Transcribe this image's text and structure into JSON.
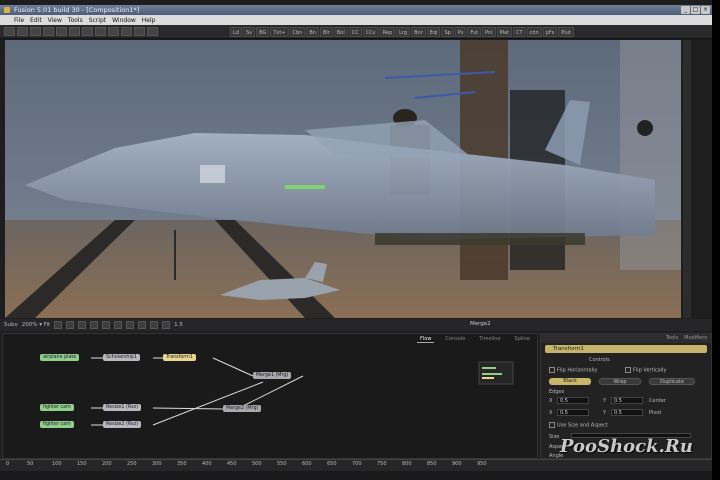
{
  "window": {
    "title": "Fusion 5.01 build 30 - [Composition1*]",
    "buttons": [
      "_",
      "□",
      "×"
    ]
  },
  "menu": [
    "File",
    "Edit",
    "View",
    "Tools",
    "Script",
    "Window",
    "Help"
  ],
  "toolbar": {
    "tools": [
      "Ld",
      "Sv",
      "BG",
      "Txt+",
      "Cbn",
      "Bn",
      "Blr",
      "Bol",
      "CC",
      "CCv",
      "Rep",
      "Lrg",
      "Bnr",
      "Eql",
      "Sp",
      "Ps",
      "Fut",
      "Pnl",
      "Mat",
      "CT",
      "cdn",
      "pFs",
      "Plut"
    ]
  },
  "viewer_bar": {
    "left_label": "Subv",
    "zoom": "200% ▾ Fit",
    "value": "1.5",
    "title": "Merge2"
  },
  "flow": {
    "tabs": [
      "Flow",
      "Console",
      "Timeline",
      "Spline"
    ],
    "nodes": [
      {
        "label": "airplane plate",
        "kind": "loader"
      },
      {
        "label": "Scholarship1",
        "kind": "xf"
      },
      {
        "label": "Transform1",
        "kind": "tr"
      },
      {
        "label": "Merge1 (Mrg)",
        "kind": "mg"
      },
      {
        "label": "fighter cam",
        "kind": "loader"
      },
      {
        "label": "fighter cam",
        "kind": "loader"
      },
      {
        "label": "Resize1 (Rsz)",
        "kind": "xf"
      },
      {
        "label": "Resize2 (Rsz)",
        "kind": "xf"
      },
      {
        "label": "Merge2 (Mrg)",
        "kind": "mg"
      }
    ]
  },
  "inspector": {
    "tabs": [
      "Tools",
      "Modifiers"
    ],
    "header": "Transform1",
    "controls_label": "Controls",
    "flip_h": "Flip Horizontally",
    "flip_v": "Flip Vertically",
    "edge_buttons": [
      "Black",
      "Wrap",
      "Duplicate"
    ],
    "edges_label": "Edges",
    "x_label": "X",
    "x_value": "0.5",
    "y_label": "Y",
    "y_value": "0.5",
    "center_label": "Center",
    "pivot_label": "Pivot",
    "use_size": "Use Size and Aspect",
    "size_label": "Size",
    "aspect_label": "Aspect",
    "angle_label": "Angle"
  },
  "ruler": {
    "ticks": [
      "0",
      "50",
      "100",
      "150",
      "200",
      "250",
      "300",
      "350",
      "400",
      "450",
      "500",
      "550",
      "600",
      "650",
      "700",
      "750",
      "800",
      "850",
      "900",
      "950"
    ]
  },
  "watermark": "PooShock.Ru",
  "colors": {
    "loader_node": "#8fcf8a",
    "transform_node": "#e6d98c",
    "inspector_header": "#c4b56a"
  }
}
